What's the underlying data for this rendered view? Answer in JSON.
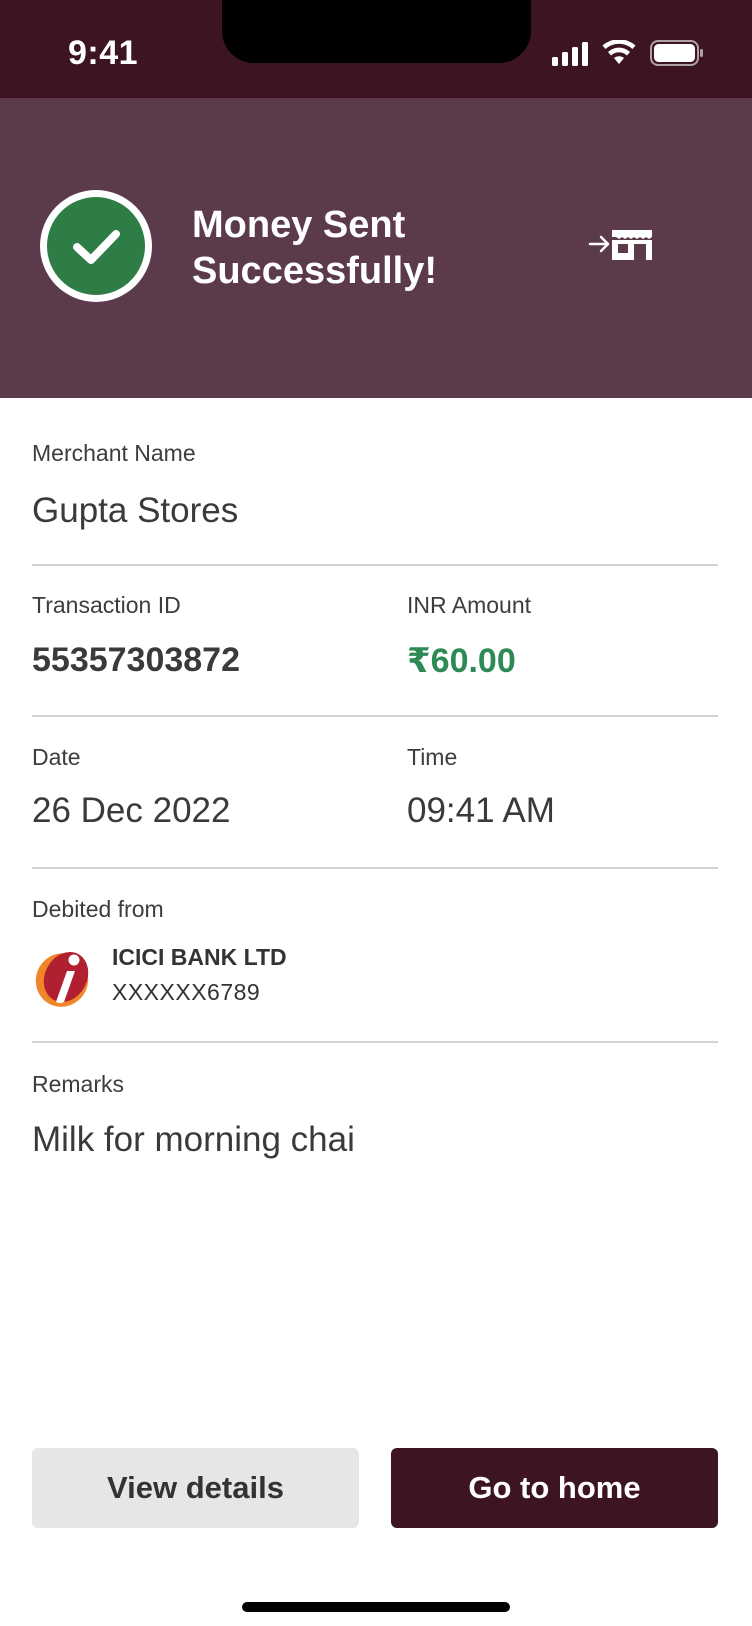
{
  "status_bar": {
    "time": "9:41"
  },
  "header": {
    "title_line1": "Money Sent",
    "title_line2": "Successfully!",
    "accent_color": "#2e7d46",
    "background_color": "#5a3a4b"
  },
  "merchant": {
    "label": "Merchant Name",
    "value": "Gupta Stores"
  },
  "transaction": {
    "label": "Transaction ID",
    "value": "55357303872"
  },
  "amount": {
    "label": "INR Amount",
    "value": "₹60.00",
    "color": "#2e8a55"
  },
  "date": {
    "label": "Date",
    "value": "26 Dec 2022"
  },
  "time": {
    "label": "Time",
    "value": "09:41 AM"
  },
  "debit": {
    "label": "Debited from",
    "bank_name": "ICICI BANK LTD",
    "account": "XXXXXX6789",
    "bank_icon": "icici-logo-icon"
  },
  "remarks": {
    "label": "Remarks",
    "value": "Milk for morning chai"
  },
  "actions": {
    "view_details": "View details",
    "go_home": "Go to home",
    "primary_color": "#3d1424"
  }
}
